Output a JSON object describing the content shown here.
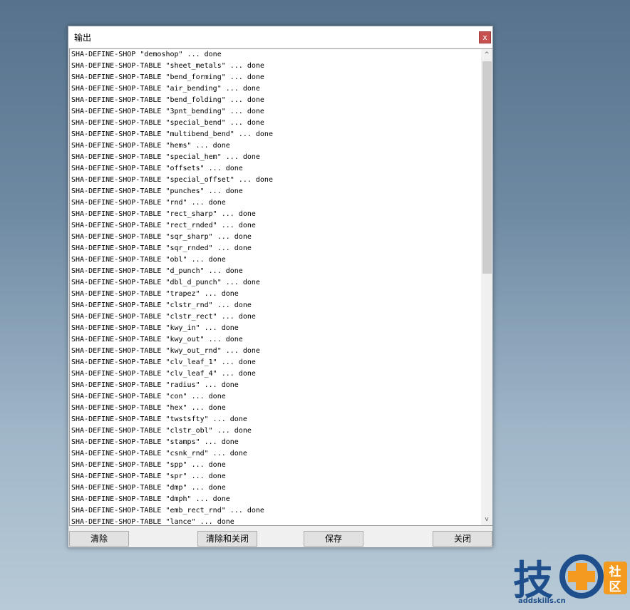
{
  "window": {
    "title": "输出",
    "close_glyph": "x"
  },
  "output_lines": [
    "SHA-DEFINE-SHOP \"demoshop\" ... done",
    "SHA-DEFINE-SHOP-TABLE \"sheet_metals\" ... done",
    "SHA-DEFINE-SHOP-TABLE \"bend_forming\" ... done",
    "SHA-DEFINE-SHOP-TABLE \"air_bending\" ... done",
    "SHA-DEFINE-SHOP-TABLE \"bend_folding\" ... done",
    "SHA-DEFINE-SHOP-TABLE \"3pnt_bending\" ... done",
    "SHA-DEFINE-SHOP-TABLE \"special_bend\" ... done",
    "SHA-DEFINE-SHOP-TABLE \"multibend_bend\" ... done",
    "SHA-DEFINE-SHOP-TABLE \"hems\" ... done",
    "SHA-DEFINE-SHOP-TABLE \"special_hem\" ... done",
    "SHA-DEFINE-SHOP-TABLE \"offsets\" ... done",
    "SHA-DEFINE-SHOP-TABLE \"special_offset\" ... done",
    "SHA-DEFINE-SHOP-TABLE \"punches\" ... done",
    "SHA-DEFINE-SHOP-TABLE \"rnd\" ... done",
    "SHA-DEFINE-SHOP-TABLE \"rect_sharp\" ... done",
    "SHA-DEFINE-SHOP-TABLE \"rect_rnded\" ... done",
    "SHA-DEFINE-SHOP-TABLE \"sqr_sharp\" ... done",
    "SHA-DEFINE-SHOP-TABLE \"sqr_rnded\" ... done",
    "SHA-DEFINE-SHOP-TABLE \"obl\" ... done",
    "SHA-DEFINE-SHOP-TABLE \"d_punch\" ... done",
    "SHA-DEFINE-SHOP-TABLE \"dbl_d_punch\" ... done",
    "SHA-DEFINE-SHOP-TABLE \"trapez\" ... done",
    "SHA-DEFINE-SHOP-TABLE \"clstr_rnd\" ... done",
    "SHA-DEFINE-SHOP-TABLE \"clstr_rect\" ... done",
    "SHA-DEFINE-SHOP-TABLE \"kwy_in\" ... done",
    "SHA-DEFINE-SHOP-TABLE \"kwy_out\" ... done",
    "SHA-DEFINE-SHOP-TABLE \"kwy_out_rnd\" ... done",
    "SHA-DEFINE-SHOP-TABLE \"clv_leaf_1\" ... done",
    "SHA-DEFINE-SHOP-TABLE \"clv_leaf_4\" ... done",
    "SHA-DEFINE-SHOP-TABLE \"radius\" ... done",
    "SHA-DEFINE-SHOP-TABLE \"con\" ... done",
    "SHA-DEFINE-SHOP-TABLE \"hex\" ... done",
    "SHA-DEFINE-SHOP-TABLE \"twstsfty\" ... done",
    "SHA-DEFINE-SHOP-TABLE \"clstr_obl\" ... done",
    "SHA-DEFINE-SHOP-TABLE \"stamps\" ... done",
    "SHA-DEFINE-SHOP-TABLE \"csnk_rnd\" ... done",
    "SHA-DEFINE-SHOP-TABLE \"spp\" ... done",
    "SHA-DEFINE-SHOP-TABLE \"spr\" ... done",
    "SHA-DEFINE-SHOP-TABLE \"dmp\" ... done",
    "SHA-DEFINE-SHOP-TABLE \"dmph\" ... done",
    "SHA-DEFINE-SHOP-TABLE \"emb_rect_rnd\" ... done",
    "SHA-DEFINE-SHOP-TABLE \"lance\" ... done"
  ],
  "scrollbar": {
    "up_glyph": "^",
    "down_glyph": "v"
  },
  "buttons": {
    "clear": "清除",
    "clear_close": "清除和关闭",
    "save": "保存",
    "close": "关闭"
  },
  "watermark": {
    "site": "addskills.cn",
    "text_1": "技",
    "text_2": "社区"
  },
  "colors": {
    "close_bg": "#c75050",
    "logo_blue": "#1e4f8c",
    "logo_orange": "#f39a1f"
  }
}
